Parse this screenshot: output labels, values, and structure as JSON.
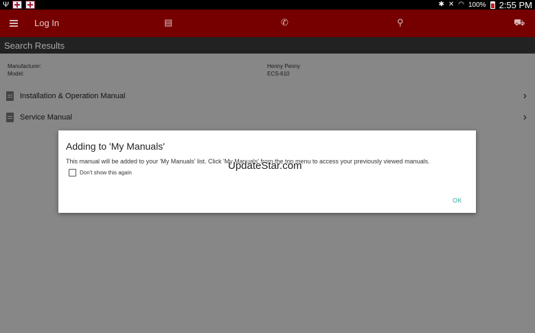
{
  "status_bar": {
    "battery_pct": "100%",
    "time": "2:55 PM"
  },
  "app_bar": {
    "login_label": "Log In"
  },
  "section": {
    "title": "Search Results"
  },
  "details": {
    "manufacturer_label": "Manufacturer:",
    "model_label": "Model:",
    "manufacturer_value": "Henny Penny",
    "model_value": "ECS-610"
  },
  "results": [
    {
      "label": "Installation & Operation Manual",
      "icon": "document-icon"
    },
    {
      "label": "Service Manual",
      "icon": "document-icon"
    }
  ],
  "dialog": {
    "title": "Adding to 'My Manuals'",
    "message": "This manual will be added to your 'My Manuals' list. Click 'My Manuals' from the top menu to access your previously viewed manuals.",
    "checkbox_label": "Don't show this again",
    "checkbox_checked": false,
    "ok_label": "OK"
  },
  "watermark": "UpdateStar.com",
  "colors": {
    "app_bar": "#760000",
    "section_bar": "#222222",
    "accent": "#2aa8a0"
  }
}
